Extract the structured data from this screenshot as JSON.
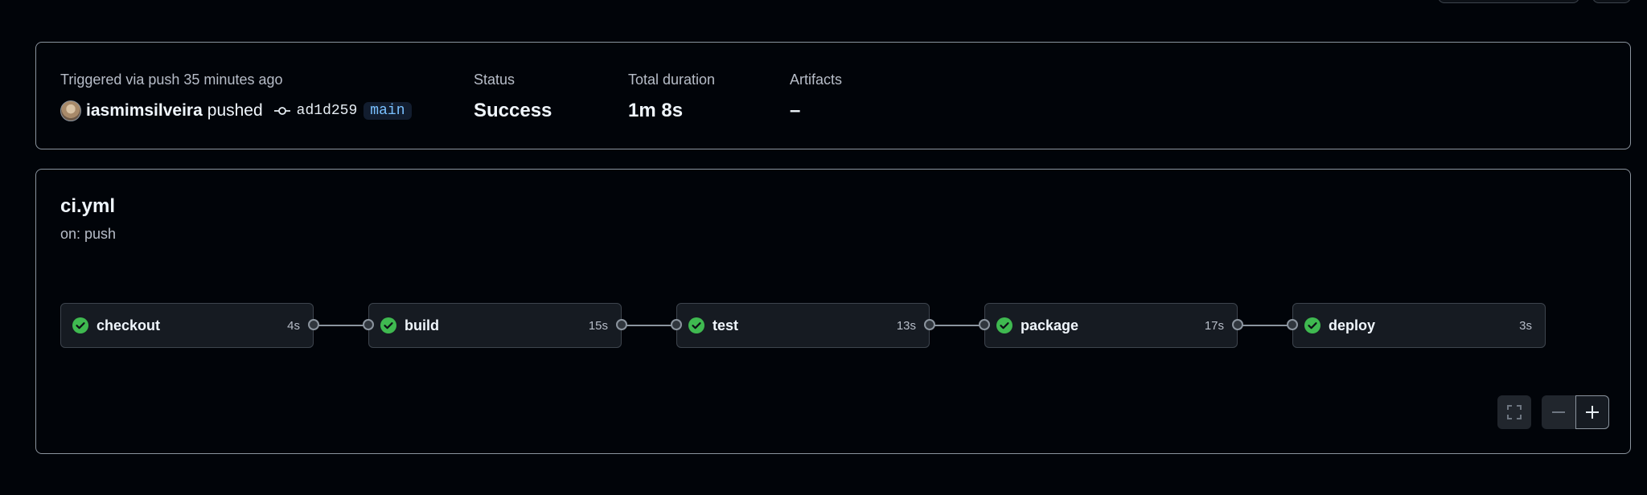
{
  "summary": {
    "trigger_text": "Triggered via push 35 minutes ago",
    "actor": "iasmimsilveira",
    "action": "pushed",
    "commit_sha": "ad1d259",
    "branch": "main",
    "status_label": "Status",
    "status_value": "Success",
    "duration_label": "Total duration",
    "duration_value": "1m 8s",
    "artifacts_label": "Artifacts",
    "artifacts_value": "–"
  },
  "workflow": {
    "file": "ci.yml",
    "trigger": "on: push",
    "jobs": [
      {
        "name": "checkout",
        "duration": "4s",
        "status": "success"
      },
      {
        "name": "build",
        "duration": "15s",
        "status": "success"
      },
      {
        "name": "test",
        "duration": "13s",
        "status": "success"
      },
      {
        "name": "package",
        "duration": "17s",
        "status": "success"
      },
      {
        "name": "deploy",
        "duration": "3s",
        "status": "success"
      }
    ]
  },
  "controls": {
    "fullscreen_icon": "fullscreen-icon",
    "zoom_out_icon": "minus-icon",
    "zoom_in_icon": "plus-icon"
  },
  "colors": {
    "success": "#3fb950",
    "background": "#010409",
    "node_bg": "#161b22",
    "branch_text": "#79c0ff"
  }
}
